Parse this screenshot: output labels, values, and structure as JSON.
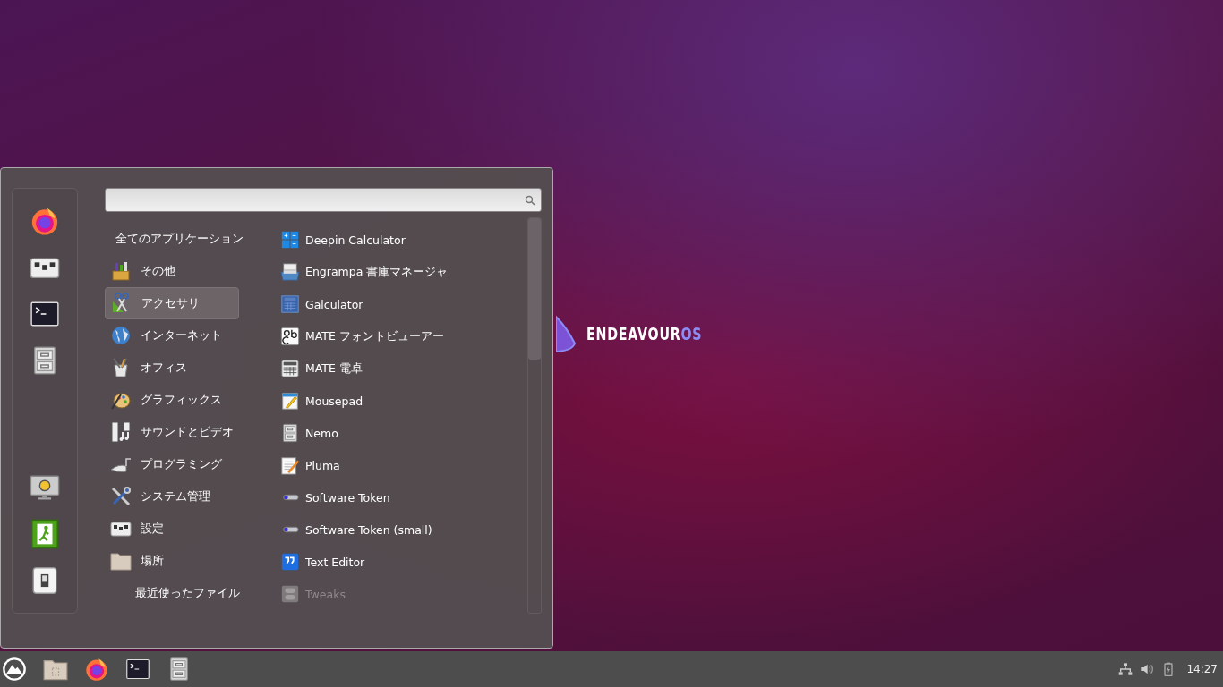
{
  "desktop_logo": {
    "main": "ENDEAVOUR",
    "accent": "OS"
  },
  "menu": {
    "categories": [
      {
        "label": "全てのアプリケーション",
        "kind": "plain",
        "selected": false
      },
      {
        "label": "その他",
        "kind": "icon",
        "selected": false
      },
      {
        "label": "アクセサリ",
        "kind": "icon",
        "selected": true
      },
      {
        "label": "インターネット",
        "kind": "icon",
        "selected": false
      },
      {
        "label": "オフィス",
        "kind": "icon",
        "selected": false
      },
      {
        "label": "グラフィックス",
        "kind": "icon",
        "selected": false
      },
      {
        "label": "サウンドとビデオ",
        "kind": "icon",
        "selected": false
      },
      {
        "label": "プログラミング",
        "kind": "icon",
        "selected": false
      },
      {
        "label": "システム管理",
        "kind": "icon",
        "selected": false
      },
      {
        "label": "設定",
        "kind": "icon",
        "selected": false
      },
      {
        "label": "場所",
        "kind": "icon",
        "selected": false
      },
      {
        "label": "最近使ったファイル",
        "kind": "plain",
        "selected": false
      }
    ],
    "apps": [
      {
        "label": "Deepin Calculator",
        "disabled": false
      },
      {
        "label": "Engrampa 書庫マネージャ",
        "disabled": false
      },
      {
        "label": "Galculator",
        "disabled": false
      },
      {
        "label": "MATE フォントビューアー",
        "disabled": false
      },
      {
        "label": "MATE 電卓",
        "disabled": false
      },
      {
        "label": "Mousepad",
        "disabled": false
      },
      {
        "label": "Nemo",
        "disabled": false
      },
      {
        "label": "Pluma",
        "disabled": false
      },
      {
        "label": "Software Token",
        "disabled": false
      },
      {
        "label": "Software Token (small)",
        "disabled": false
      },
      {
        "label": "Text Editor",
        "disabled": false
      },
      {
        "label": "Tweaks",
        "disabled": true
      }
    ]
  },
  "taskbar": {
    "clock": "14:27"
  }
}
